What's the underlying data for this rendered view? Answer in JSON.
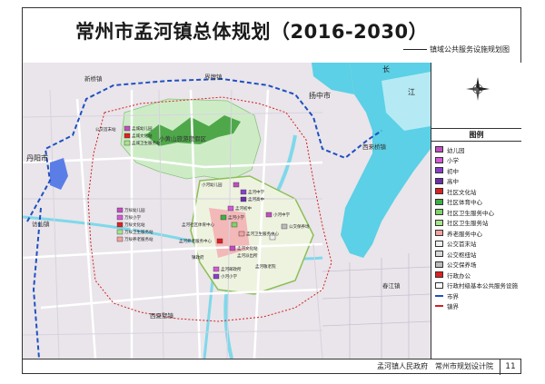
{
  "title": "常州市孟河镇总体规划（2016-2030）",
  "subtitle": "镇域公共服务设施规划图",
  "map": {
    "places": {
      "xinqiao": "新桥镇",
      "jiechai": "界牌镇",
      "chang": "长",
      "jiang": "江",
      "yangzhong": "扬中市",
      "danyang": "丹阳市",
      "xilaiqiao": "西来桥镇",
      "fanggu": "访仙镇",
      "xiaohuangshan": "小黄山旅游度假区",
      "chunjiang": "春江镇",
      "xiaxi": "西夏墅镇"
    },
    "facilities": [
      "公交首末站",
      "孟城幼儿园",
      "孟城文化站",
      "孟城卫生服务站",
      "万绥幼儿园",
      "万绥小学",
      "万绥文化站",
      "万绥卫生服务站",
      "万绥养老服务站",
      "小河幼儿园",
      "孟河中学",
      "孟河高中",
      "孟河初中",
      "孟河小学",
      "孟河社区体育中心",
      "孟河卫生服务中心",
      "孟河养老服务中心",
      "孟河文化站",
      "孟河派出所",
      "镇政府",
      "孟河邮政所",
      "小河小学",
      "小河中学",
      "孟河敬老院",
      "公交保养场"
    ]
  },
  "legend": {
    "title": "图例",
    "items": [
      {
        "label": "幼儿园",
        "color": "#c04fc0"
      },
      {
        "label": "小学",
        "color": "#d35ad8"
      },
      {
        "label": "初中",
        "color": "#8a3fc9"
      },
      {
        "label": "高中",
        "color": "#6b2fa8"
      },
      {
        "label": "社区文化站",
        "color": "#e02020"
      },
      {
        "label": "社区体育中心",
        "color": "#3cb044"
      },
      {
        "label": "社区卫生服务中心",
        "color": "#7ed36a"
      },
      {
        "label": "社区卫生服务站",
        "color": "#a6e38c"
      },
      {
        "label": "养老服务中心",
        "color": "#f1a1a1"
      },
      {
        "label": "公交首末站",
        "color": "#f0f0f0"
      },
      {
        "label": "公交枢纽站",
        "color": "#d8d8d8"
      },
      {
        "label": "公交保养场",
        "color": "#bcbcbc"
      },
      {
        "label": "行政办公",
        "color": "#e02020"
      },
      {
        "label": "行政村级基本公共服务设施",
        "color": "#ffffff"
      }
    ],
    "lines": [
      {
        "label": "市界",
        "color": "#2050c0"
      },
      {
        "label": "镇界",
        "color": "#d02020"
      }
    ]
  },
  "footer": {
    "text": "孟河镇人民政府　常州市规划设计院",
    "page": "11"
  }
}
